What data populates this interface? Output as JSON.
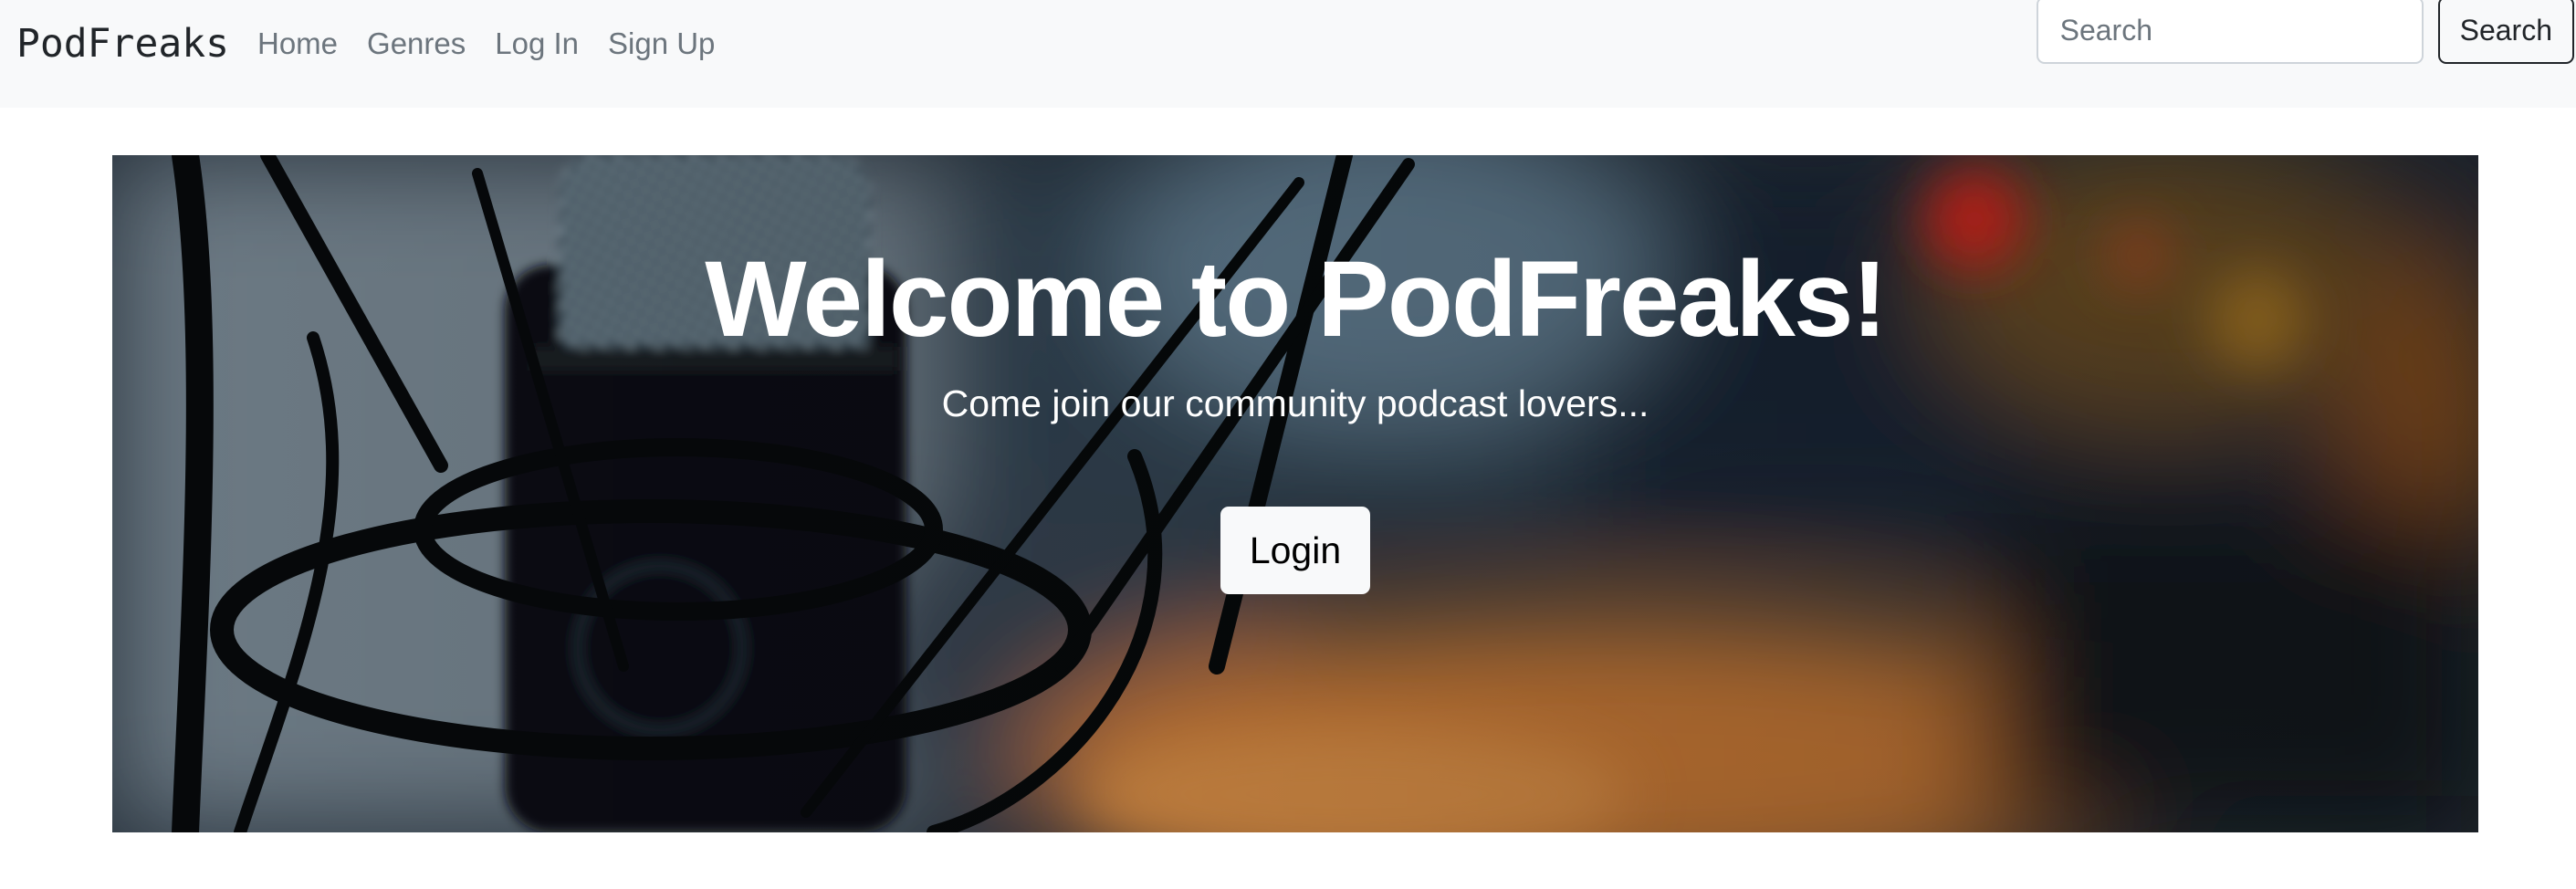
{
  "navbar": {
    "brand": "PodFreaks",
    "links": [
      {
        "label": "Home"
      },
      {
        "label": "Genres"
      },
      {
        "label": "Log In"
      },
      {
        "label": "Sign Up"
      }
    ],
    "search": {
      "placeholder": "Search",
      "value": "",
      "button_label": "Search"
    }
  },
  "hero": {
    "title": "Welcome to PodFreaks!",
    "subtitle": "Come join our community podcast lovers...",
    "button_label": "Login",
    "background_image": "microphone-photo"
  },
  "colors": {
    "navbar_bg": "#f8f9fa",
    "text_dark": "#212529",
    "nav_link": "#6c757d",
    "hero_text": "#ffffff",
    "button_light": "#f8f9fa"
  }
}
